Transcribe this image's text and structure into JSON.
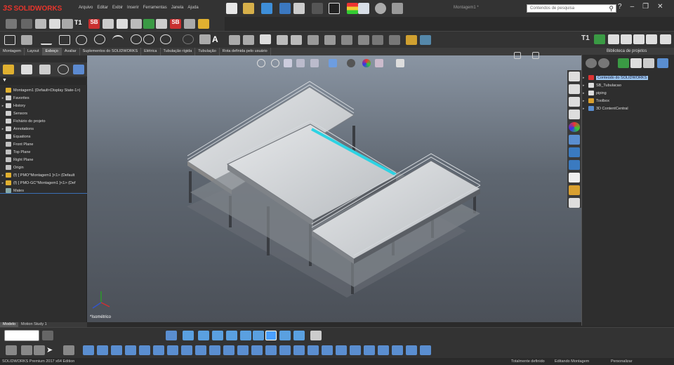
{
  "app": {
    "brand_ds": "3S",
    "brand": "SOLIDWORKS",
    "doc_title": "Montagem1 *"
  },
  "menu": [
    "Arquivo",
    "Editar",
    "Exibir",
    "Inserir",
    "Ferramentas",
    "Janela",
    "Ajuda"
  ],
  "search": {
    "placeholder": "Contendos de pesquisa"
  },
  "window_buttons": {
    "help": "?",
    "minimize": "–",
    "restore": "❐",
    "close": "✕"
  },
  "toolbar": {
    "t1": "T1",
    "sb": "SB"
  },
  "tabs": [
    {
      "label": "Montagem",
      "active": false
    },
    {
      "label": "Layout",
      "active": false
    },
    {
      "label": "Esboço",
      "active": true
    },
    {
      "label": "Avaliar",
      "active": false
    },
    {
      "label": "Suplementos do SOLIDWORKS",
      "active": false
    },
    {
      "label": "Elétrica",
      "active": false
    },
    {
      "label": "Tubulação rígida",
      "active": false
    },
    {
      "label": "Tubulação",
      "active": false
    },
    {
      "label": "Rota definida pelo usuário",
      "active": false
    }
  ],
  "tree": [
    {
      "label": "Montagem1 (Default<Display State-1>)",
      "arrow": "",
      "icon": "assembly-icon",
      "color": "#e0b030"
    },
    {
      "label": "Favorites",
      "arrow": "▸",
      "icon": "favorites-icon",
      "color": "#d0d0d0"
    },
    {
      "label": "History",
      "arrow": "▸",
      "icon": "history-icon",
      "color": "#d0d0d0"
    },
    {
      "label": "Sensors",
      "arrow": "",
      "icon": "sensors-icon",
      "color": "#d0d0d0"
    },
    {
      "label": "Fichário do projeto",
      "arrow": "",
      "icon": "binder-icon",
      "color": "#d0d0d0"
    },
    {
      "label": "Annotations",
      "arrow": "▸",
      "icon": "annotations-icon",
      "color": "#d0d0d0"
    },
    {
      "label": "Equations",
      "arrow": "",
      "icon": "equations-icon",
      "color": "#d0d0d0"
    },
    {
      "label": "Front Plane",
      "arrow": "",
      "icon": "plane-icon",
      "color": "#c0c0c0"
    },
    {
      "label": "Top Plane",
      "arrow": "",
      "icon": "plane-icon",
      "color": "#c0c0c0"
    },
    {
      "label": "Right Plane",
      "arrow": "",
      "icon": "plane-icon",
      "color": "#c0c0c0"
    },
    {
      "label": "Origin",
      "arrow": "",
      "icon": "origin-icon",
      "color": "#c0c0c0"
    },
    {
      "label": "(f) [ PMO^Montagem1 ]<1> (Default",
      "arrow": "▸",
      "icon": "subassembly-icon",
      "color": "#e0b030"
    },
    {
      "label": "(f) [ PMO-GC^Montagem1 ]<1> (Def",
      "arrow": "▸",
      "icon": "subassembly-icon",
      "color": "#e0b030"
    },
    {
      "label": "Mates",
      "arrow": "",
      "icon": "mates-icon",
      "color": "#8aa"
    }
  ],
  "viewport": {
    "view_label": "*Isométrico"
  },
  "bottom_tabs": [
    "Modelo",
    "Motion Study 1"
  ],
  "library": {
    "title": "Biblioteca de projetos",
    "items": [
      {
        "label": "Conteúdo do SOLIDWORKS",
        "selected": true,
        "icon": "sw-content-icon",
        "color": "#d33"
      },
      {
        "label": "SB_Tubulacao",
        "selected": false,
        "icon": "folder-icon",
        "color": "#ddd"
      },
      {
        "label": "piping",
        "selected": false,
        "icon": "folder-icon",
        "color": "#ddd"
      },
      {
        "label": "Toolbox",
        "selected": false,
        "icon": "toolbox-icon",
        "color": "#d9a030"
      },
      {
        "label": "3D ContentCentral",
        "selected": false,
        "icon": "content-central-icon",
        "color": "#5a8ed0"
      }
    ]
  },
  "status": {
    "edition": "SOLIDWORKS Premium 2017 x64 Edition",
    "defined": "Totalmente definido",
    "mode": "Editando Montagem",
    "custom": "Personalizar"
  }
}
